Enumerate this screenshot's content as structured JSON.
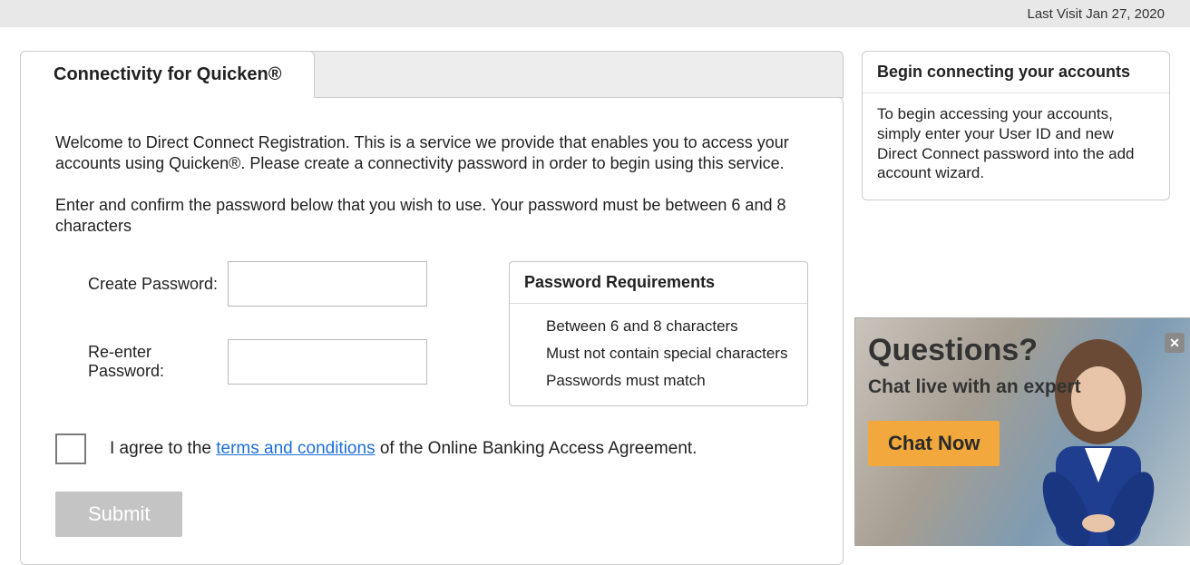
{
  "header": {
    "last_visit": "Last Visit Jan 27, 2020"
  },
  "tab": {
    "title": "Connectivity for Quicken®"
  },
  "intro": "Welcome to Direct Connect Registration. This is a service we provide that enables you to access your accounts using Quicken®. Please create a connectivity password in order to begin using this service.",
  "instruction": "Enter and confirm the password below that you wish to use. Your password must be between 6 and 8 characters",
  "form": {
    "create_label": "Create Password:",
    "reenter_label": "Re-enter Password:",
    "create_value": "",
    "reenter_value": ""
  },
  "requirements": {
    "title": "Password Requirements",
    "items": [
      "Between 6 and 8 characters",
      "Must not contain special characters",
      "Passwords must match"
    ]
  },
  "agree": {
    "prefix": "I agree to the ",
    "link": "terms and conditions",
    "suffix": " of the Online Banking Access Agreement."
  },
  "submit_label": "Submit",
  "sidebar": {
    "title": "Begin connecting your accounts",
    "body": "To begin accessing your accounts, simply enter your User ID and new Direct Connect password into the add account wizard."
  },
  "chat": {
    "heading": "Questions?",
    "subtext": "Chat live with an expert",
    "button": "Chat Now",
    "close": "✕"
  }
}
